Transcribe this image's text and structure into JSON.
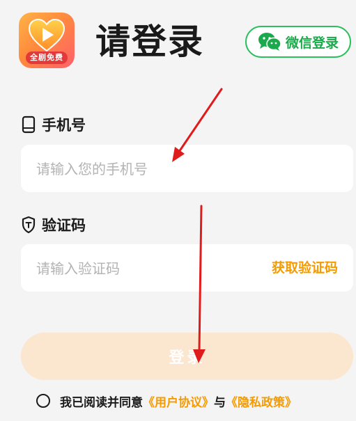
{
  "header": {
    "logo_caption": "全剧免费",
    "title": "请登录",
    "wechat_login_label": "微信登录"
  },
  "phone": {
    "label": "手机号",
    "placeholder": "请输入您的手机号",
    "icon": "phone-icon"
  },
  "code": {
    "label": "验证码",
    "placeholder": "请输入验证码",
    "get_code_label": "获取验证码",
    "icon": "shield-icon"
  },
  "login_button_label": "登录",
  "agreement": {
    "prefix": "我已阅读并同意",
    "user_agreement": "《用户协议》",
    "joiner": "与",
    "privacy_policy": "《隐私政策》"
  },
  "colors": {
    "accent_orange": "#f59b00",
    "wechat_green": "#2bbf5e",
    "login_button_disabled": "#fbe6cf",
    "annotation_red": "#e01b1b",
    "background": "#f4f4f4"
  }
}
